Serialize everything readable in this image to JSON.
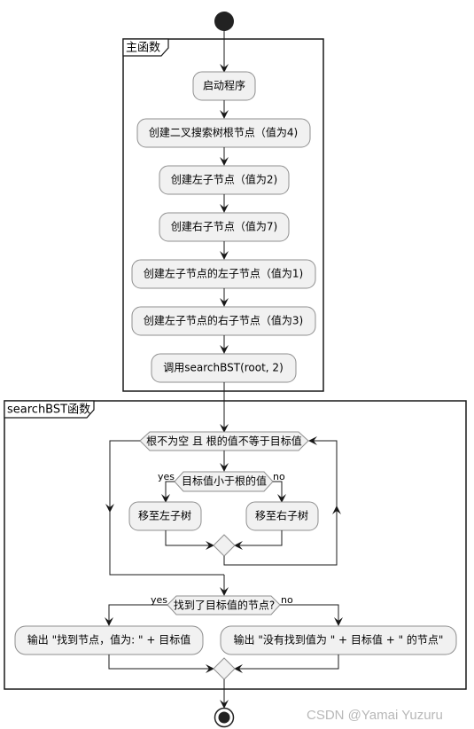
{
  "diagram": {
    "type": "activity",
    "main_partition": {
      "title": "主函数",
      "steps": [
        "启动程序",
        "创建二叉搜索树根节点（值为4)",
        "创建左子节点（值为2)",
        "创建右子节点（值为7)",
        "创建左子节点的左子节点（值为1)",
        "创建左子节点的右子节点（值为3)",
        "调用searchBST(root, 2)"
      ]
    },
    "search_partition": {
      "title": "searchBST函数",
      "loop_condition": "根不为空 且 根的值不等于目标值",
      "inner_condition": "目标值小于根的值",
      "inner_yes_label": "yes",
      "inner_no_label": "no",
      "yes_action": "移至左子树",
      "no_action": "移至右子树",
      "found_condition": "找到了目标值的节点?",
      "found_yes_label": "yes",
      "found_no_label": "no",
      "found_action": "输出 \"找到节点，值为: \" + 目标值",
      "not_found_action": "输出 \"没有找到值为 \" + 目标值 + \" 的节点\""
    },
    "watermark": "CSDN @Yamai Yuzuru",
    "colors": {
      "node_fill": "#f1f1f1",
      "node_border": "#8f8f8f",
      "line": "#181818"
    }
  }
}
